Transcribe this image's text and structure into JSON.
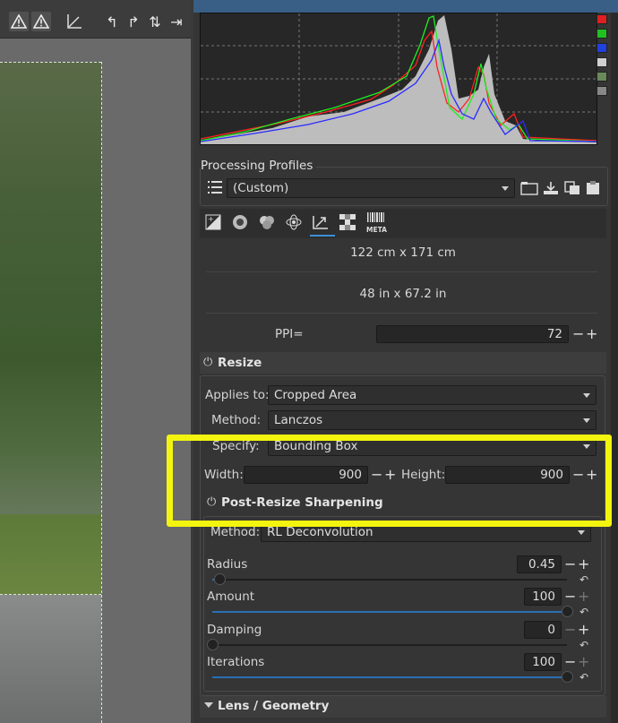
{
  "toolbar": {
    "icons": [
      "warning-icon",
      "warning-icon-2",
      "graph-icon",
      "rotate-left-icon",
      "rotate-right-icon",
      "flip-vertical-icon",
      "flip-horizontal-icon"
    ]
  },
  "histogram": {
    "channels": [
      "red",
      "green",
      "blue",
      "luminance"
    ],
    "channel_colors": {
      "red": "#ff2020",
      "green": "#20ee20",
      "blue": "#2a2aff",
      "lum": "#bdbdbd"
    }
  },
  "processing_profiles": {
    "title": "Processing Profiles",
    "selected": "(Custom)"
  },
  "tool_tabs": [
    "exposure-tab-icon",
    "detail-tab-icon",
    "color-tab-icon",
    "advanced-tab-icon",
    "transform-tab-icon",
    "raw-tab-icon",
    "META"
  ],
  "size_info": {
    "cm": "122 cm x 171 cm",
    "inches": "48 in x 67.2 in",
    "ppi_label": "PPI=",
    "ppi_value": "72"
  },
  "resize": {
    "title": "Resize",
    "applies_to_label": "Applies to:",
    "applies_to_value": "Cropped Area",
    "method_label": "Method:",
    "method_value": "Lanczos",
    "specify_label": "Specify:",
    "specify_value": "Bounding Box",
    "width_label": "Width:",
    "width_value": "900",
    "height_label": "Height:",
    "height_value": "900"
  },
  "sharpening": {
    "title": "Post-Resize Sharpening",
    "method_label": "Method:",
    "method_value": "RL Deconvolution",
    "radius_label": "Radius",
    "radius_value": "0.45",
    "amount_label": "Amount",
    "amount_value": "100",
    "damping_label": "Damping",
    "damping_value": "0",
    "iterations_label": "Iterations",
    "iterations_value": "100",
    "radius_level": 0.02,
    "amount_level": 1.0,
    "damping_level": 0.0,
    "iterations_level": 1.0
  },
  "lens": {
    "title": "Lens / Geometry"
  }
}
